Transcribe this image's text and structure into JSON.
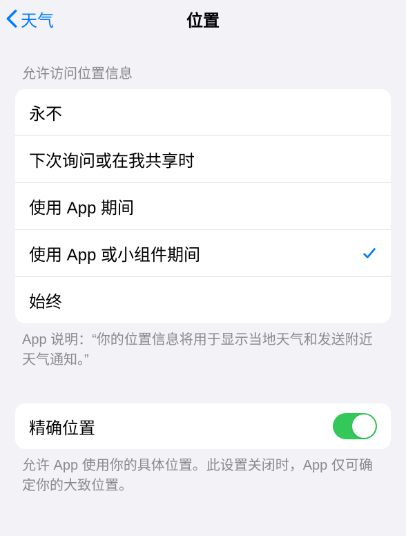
{
  "nav": {
    "back_label": "天气",
    "title": "位置"
  },
  "access_section": {
    "header": "允许访问位置信息",
    "options": [
      {
        "label": "永不",
        "selected": false
      },
      {
        "label": "下次询问或在我共享时",
        "selected": false
      },
      {
        "label": "使用 App 期间",
        "selected": false
      },
      {
        "label": "使用 App 或小组件期间",
        "selected": true
      },
      {
        "label": "始终",
        "selected": false
      }
    ],
    "footer": "App 说明：“你的位置信息将用于显示当地天气和发送附近天气通知。”"
  },
  "precise_section": {
    "label": "精确位置",
    "enabled": true,
    "footer": "允许 App 使用你的具体位置。此设置关闭时，App 仅可确定你的大致位置。"
  }
}
